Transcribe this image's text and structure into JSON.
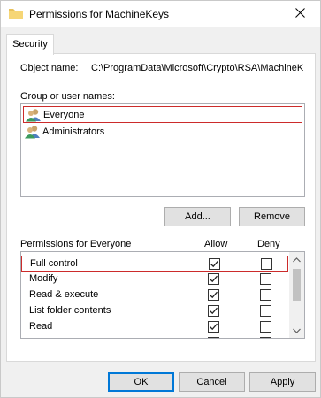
{
  "window": {
    "title": "Permissions for MachineKeys"
  },
  "tab": {
    "label": "Security"
  },
  "object": {
    "label": "Object name:",
    "value": "C:\\ProgramData\\Microsoft\\Crypto\\RSA\\MachineK"
  },
  "group_section": {
    "label": "Group or user names:",
    "items": [
      {
        "name": "Everyone",
        "selected": true
      },
      {
        "name": "Administrators",
        "selected": false
      }
    ]
  },
  "buttons": {
    "add": "Add...",
    "remove": "Remove",
    "ok": "OK",
    "cancel": "Cancel",
    "apply": "Apply"
  },
  "permissions": {
    "header": "Permissions for Everyone",
    "allow_label": "Allow",
    "deny_label": "Deny",
    "rows": [
      {
        "label": "Full control",
        "allow": true,
        "deny": false
      },
      {
        "label": "Modify",
        "allow": true,
        "deny": false
      },
      {
        "label": "Read & execute",
        "allow": true,
        "deny": false
      },
      {
        "label": "List folder contents",
        "allow": true,
        "deny": false
      },
      {
        "label": "Read",
        "allow": true,
        "deny": false
      },
      {
        "label": "",
        "allow": true,
        "deny": false
      }
    ]
  },
  "colors": {
    "selection_outline": "#cc2b2b",
    "default_button_border": "#0078d7"
  }
}
